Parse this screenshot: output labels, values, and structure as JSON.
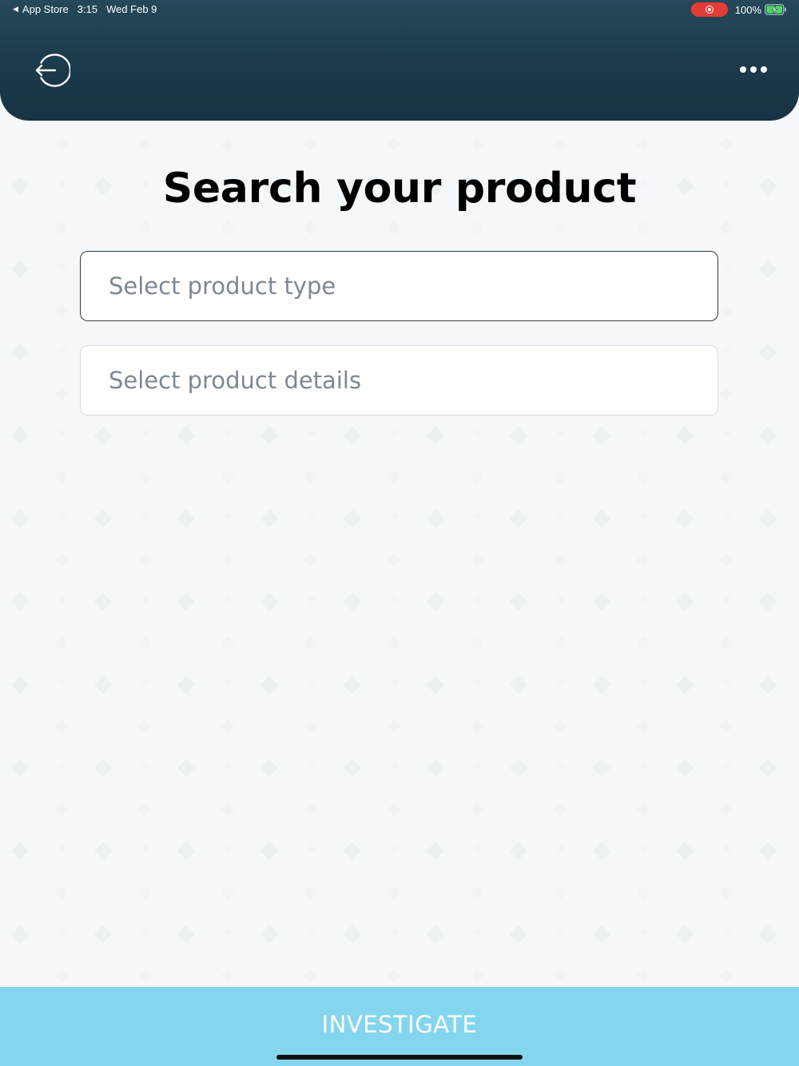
{
  "status_bar": {
    "back_app": "App Store",
    "time": "3:15",
    "date": "Wed Feb 9",
    "battery": "100%"
  },
  "header": {
    "back_icon": "logout-back-icon",
    "menu_icon": "more-horizontal-icon"
  },
  "main": {
    "title": "Search your product",
    "product_type": {
      "value": "",
      "placeholder": "Select product type"
    },
    "product_details": {
      "value": "",
      "placeholder": "Select product details"
    }
  },
  "footer": {
    "investigate_label": "INVESTIGATE"
  },
  "colors": {
    "header": "#1b3a4b",
    "button": "#84d6ee",
    "placeholder": "#7c8896",
    "recording": "#e33b35",
    "battery": "#4cd964"
  }
}
